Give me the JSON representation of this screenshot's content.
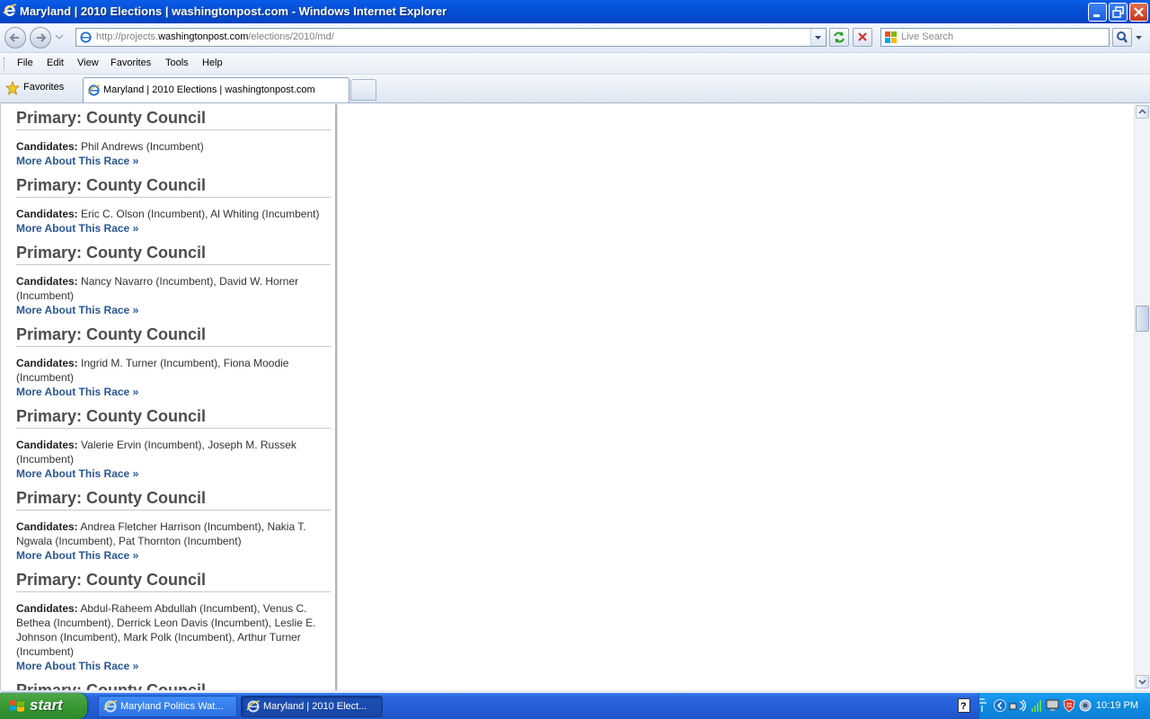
{
  "window": {
    "title": "Maryland | 2010 Elections | washingtonpost.com - Windows Internet Explorer"
  },
  "navbar": {
    "url_prefix": "http://projects.",
    "url_domain": "washingtonpost.com",
    "url_path": "/elections/2010/md/",
    "search_placeholder": "Live Search"
  },
  "menu": {
    "items": [
      "File",
      "Edit",
      "View",
      "Favorites",
      "Tools",
      "Help"
    ]
  },
  "favorites_bar": {
    "favorites_label": "Favorites",
    "active_tab_label": "Maryland | 2010 Elections | washingtonpost.com"
  },
  "page": {
    "race_title": "Primary: County Council",
    "candidates_label": "Candidates:",
    "more_link": "More About This Race »",
    "races": [
      {
        "candidates": "Phil Andrews (Incumbent)"
      },
      {
        "candidates": "Eric C. Olson (Incumbent), Al Whiting (Incumbent)"
      },
      {
        "candidates": "Nancy Navarro (Incumbent), David W. Horner (Incumbent)"
      },
      {
        "candidates": "Ingrid M. Turner (Incumbent), Fiona Moodie (Incumbent)"
      },
      {
        "candidates": "Valerie Ervin (Incumbent), Joseph M. Russek (Incumbent)"
      },
      {
        "candidates": "Andrea Fletcher Harrison (Incumbent), Nakia T. Ngwala (Incumbent), Pat Thornton (Incumbent)"
      },
      {
        "candidates": "Abdul-Raheem Abdullah (Incumbent), Venus C. Bethea (Incumbent), Derrick Leon Davis (Incumbent), Leslie E. Johnson (Incumbent), Mark Polk (Incumbent), Arthur Turner (Incumbent)"
      }
    ],
    "partial_title": "Primary: County Council"
  },
  "taskbar": {
    "start_label": "start",
    "items": [
      {
        "label": "Maryland Politics Wat..."
      },
      {
        "label": "Maryland | 2010 Elect..."
      }
    ],
    "clock": "10:19 PM"
  },
  "colors": {
    "titlebar": "#0450d6",
    "link": "#2a5796",
    "taskbar": "#245ed8",
    "start_button": "#379834"
  }
}
